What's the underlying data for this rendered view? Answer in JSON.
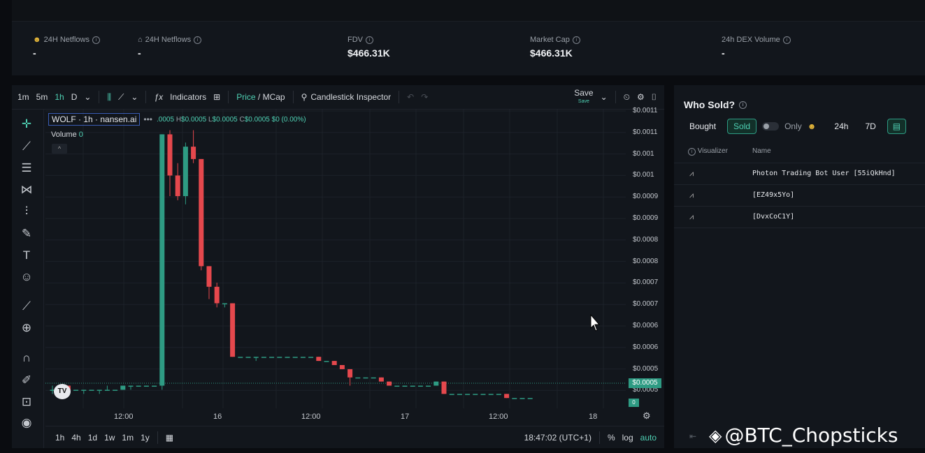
{
  "stats": [
    {
      "label": "24H Netflows",
      "value": "-",
      "icon": "smile-icon"
    },
    {
      "label": "24H Netflows",
      "value": "-",
      "icon": "bank-icon"
    },
    {
      "label": "FDV",
      "value": "$466.31K"
    },
    {
      "label": "Market Cap",
      "value": "$466.31K"
    },
    {
      "label": "24h DEX Volume",
      "value": "-"
    }
  ],
  "toolbar": {
    "tf_1m": "1m",
    "tf_5m": "5m",
    "tf_1h": "1h",
    "tf_d": "D",
    "indicators": "Indicators",
    "price": "Price",
    "slash": " / ",
    "mcap": "MCap",
    "inspector": "Candlestick Inspector",
    "save": "Save",
    "save_sub": "Save"
  },
  "legend": {
    "symbol": "WOLF · 1h · nansen.ai",
    "ohlc_tail": ".0005",
    "h_label": "H",
    "h_val": "$0.0005",
    "l_label": "L",
    "l_val": "$0.0005",
    "c_label": "C",
    "c_val": "$0.0005",
    "chg": "$0 (0.00%)",
    "volume_label": "Volume",
    "volume_val": "0"
  },
  "yaxis": [
    "$0.0011",
    "$0.0011",
    "$0.001",
    "$0.001",
    "$0.0009",
    "$0.0009",
    "$0.0008",
    "$0.0008",
    "$0.0007",
    "$0.0007",
    "$0.0006",
    "$0.0006",
    "$0.0005",
    "$0.0005"
  ],
  "last_price": "$0.0005",
  "xaxis": [
    "12:00",
    "16",
    "12:00",
    "17",
    "12:00",
    "18"
  ],
  "bottom": {
    "ranges": [
      "1h",
      "4h",
      "1d",
      "1w",
      "1m",
      "1y"
    ],
    "time": "18:47:02 (UTC+1)",
    "pct": "%",
    "log": "log",
    "auto": "auto"
  },
  "chart_data": {
    "type": "candlestick",
    "candles": [
      [
        0.0005,
        0.00051,
        0.00049,
        0.0005
      ],
      [
        0.0005,
        0.00051,
        0.0005,
        0.00051
      ],
      [
        0.00051,
        0.00051,
        0.0005,
        0.0005
      ],
      [
        0.0005,
        0.0005,
        0.0005,
        0.0005
      ],
      [
        0.0005,
        0.0005,
        0.00049,
        0.0005
      ],
      [
        0.0005,
        0.0005,
        0.0005,
        0.0005
      ],
      [
        0.0005,
        0.0005,
        0.00049,
        0.0005
      ],
      [
        0.0005,
        0.00051,
        0.0005,
        0.0005
      ],
      [
        0.0005,
        0.0005,
        0.0005,
        0.0005
      ],
      [
        0.0005,
        0.00051,
        0.0005,
        0.00051
      ],
      [
        0.00051,
        0.00051,
        0.0005,
        0.00051
      ],
      [
        0.00051,
        0.00051,
        0.00051,
        0.00051
      ],
      [
        0.00051,
        0.00051,
        0.00051,
        0.00051
      ],
      [
        0.00051,
        0.00051,
        0.00051,
        0.00051
      ],
      [
        0.00051,
        0.00112,
        0.0005,
        0.00112
      ],
      [
        0.00112,
        0.00113,
        0.00097,
        0.00102
      ],
      [
        0.00102,
        0.00105,
        0.00096,
        0.00097
      ],
      [
        0.00097,
        0.0011,
        0.00095,
        0.00109
      ],
      [
        0.00109,
        0.00113,
        0.00105,
        0.00106
      ],
      [
        0.00106,
        0.00106,
        0.00079,
        0.0008
      ],
      [
        0.0008,
        0.0008,
        0.00072,
        0.00075
      ],
      [
        0.00075,
        0.00076,
        0.0007,
        0.00071
      ],
      [
        0.00071,
        0.00071,
        0.0007,
        0.00071
      ],
      [
        0.00071,
        0.00071,
        0.00058,
        0.00058
      ],
      [
        0.00058,
        0.00058,
        0.00058,
        0.00058
      ],
      [
        0.00058,
        0.00058,
        0.00058,
        0.00058
      ],
      [
        0.00058,
        0.00058,
        0.00057,
        0.00058
      ],
      [
        0.00058,
        0.00058,
        0.00058,
        0.00058
      ],
      [
        0.00058,
        0.00058,
        0.00058,
        0.00058
      ],
      [
        0.00058,
        0.00058,
        0.00058,
        0.00058
      ],
      [
        0.00058,
        0.00058,
        0.00058,
        0.00058
      ],
      [
        0.00058,
        0.00058,
        0.00058,
        0.00058
      ],
      [
        0.00058,
        0.00058,
        0.00058,
        0.00058
      ],
      [
        0.00058,
        0.00058,
        0.00058,
        0.00058
      ],
      [
        0.00058,
        0.00058,
        0.00057,
        0.00057
      ],
      [
        0.00057,
        0.00057,
        0.00057,
        0.00057
      ],
      [
        0.00057,
        0.00057,
        0.00056,
        0.00056
      ],
      [
        0.00056,
        0.00056,
        0.00055,
        0.00055
      ],
      [
        0.00055,
        0.00055,
        0.00051,
        0.00053
      ],
      [
        0.00053,
        0.00053,
        0.00053,
        0.00053
      ],
      [
        0.00053,
        0.00053,
        0.00053,
        0.00053
      ],
      [
        0.00053,
        0.00053,
        0.00053,
        0.00053
      ],
      [
        0.00053,
        0.00053,
        0.00052,
        0.00052
      ],
      [
        0.00052,
        0.00052,
        0.00051,
        0.00051
      ],
      [
        0.00051,
        0.00051,
        0.00051,
        0.00051
      ],
      [
        0.00051,
        0.00051,
        0.00051,
        0.00051
      ],
      [
        0.00051,
        0.00051,
        0.00051,
        0.00051
      ],
      [
        0.00051,
        0.00051,
        0.00051,
        0.00051
      ],
      [
        0.00051,
        0.00051,
        0.00051,
        0.00051
      ],
      [
        0.00051,
        0.00052,
        0.00051,
        0.00052
      ],
      [
        0.00052,
        0.00052,
        0.00049,
        0.00049
      ],
      [
        0.00049,
        0.00049,
        0.00049,
        0.00049
      ],
      [
        0.00049,
        0.00049,
        0.00049,
        0.00049
      ],
      [
        0.00049,
        0.00049,
        0.00049,
        0.00049
      ],
      [
        0.00049,
        0.00049,
        0.00049,
        0.00049
      ],
      [
        0.00049,
        0.00049,
        0.00049,
        0.00049
      ],
      [
        0.00049,
        0.00049,
        0.00049,
        0.00049
      ],
      [
        0.00049,
        0.00049,
        0.00049,
        0.00049
      ],
      [
        0.00049,
        0.00049,
        0.00048,
        0.00048
      ],
      [
        0.00048,
        0.00048,
        0.00048,
        0.00048
      ],
      [
        0.00048,
        0.00048,
        0.00048,
        0.00048
      ],
      [
        0.00048,
        0.00048,
        0.00048,
        0.00048
      ]
    ],
    "ylim": [
      0.000455,
      0.00118
    ],
    "colors": {
      "up": "#2e9b83",
      "down": "#e5484d"
    }
  },
  "panel": {
    "title": "Who Sold?",
    "bought": "Bought",
    "sold": "Sold",
    "only": "Only",
    "t24h": "24h",
    "t7d": "7D",
    "col_visualizer": "Visualizer",
    "col_name": "Name",
    "rows": [
      {
        "name": "Photon Trading Bot User [55iQkHnd]"
      },
      {
        "name": "[EZ49x5Yo]"
      },
      {
        "name": "[DvxCoC1Y]"
      }
    ]
  },
  "watermark": "@BTC_Chopsticks"
}
